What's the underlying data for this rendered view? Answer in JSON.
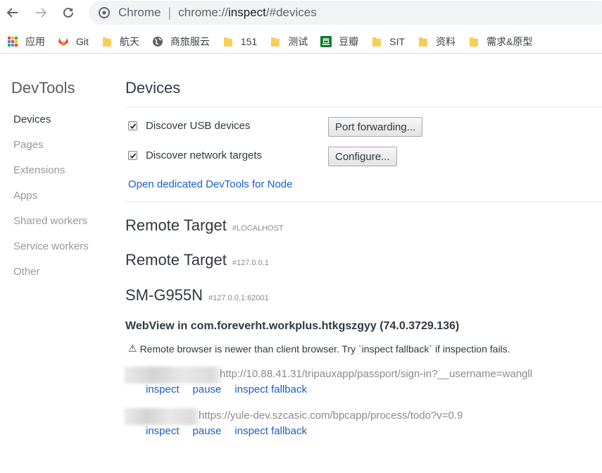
{
  "toolbar": {
    "chrome_label": "Chrome",
    "url_scheme": "chrome://",
    "url_host": "inspect",
    "url_path": "/#devices"
  },
  "bookmarks": [
    {
      "label": "应用",
      "icon": "apps-grid-icon"
    },
    {
      "label": "Git",
      "icon": "gitlab-icon"
    },
    {
      "label": "航天",
      "icon": "folder-icon"
    },
    {
      "label": "商旅服云",
      "icon": "globe-icon"
    },
    {
      "label": "151",
      "icon": "folder-icon"
    },
    {
      "label": "测试",
      "icon": "folder-icon"
    },
    {
      "label": "豆瓣",
      "icon": "douban-icon"
    },
    {
      "label": "SIT",
      "icon": "folder-icon"
    },
    {
      "label": "资料",
      "icon": "folder-icon"
    },
    {
      "label": "需求&原型",
      "icon": "folder-icon"
    }
  ],
  "sidebar": {
    "title": "DevTools",
    "items": [
      {
        "label": "Devices",
        "active": true
      },
      {
        "label": "Pages"
      },
      {
        "label": "Extensions"
      },
      {
        "label": "Apps"
      },
      {
        "label": "Shared workers"
      },
      {
        "label": "Service workers"
      },
      {
        "label": "Other"
      }
    ]
  },
  "main": {
    "title": "Devices",
    "discover_usb": {
      "label": "Discover USB devices",
      "checked": true,
      "button": "Port forwarding..."
    },
    "discover_network": {
      "label": "Discover network targets",
      "checked": true,
      "button": "Configure..."
    },
    "open_node_link": "Open dedicated DevTools for Node",
    "targets": [
      {
        "name": "Remote Target",
        "addr": "#LOCALHOST"
      },
      {
        "name": "Remote Target",
        "addr": "#127.0.0.1"
      },
      {
        "name": "SM-G955N",
        "addr": "#127.0.0.1:62001"
      }
    ],
    "webview_title": "WebView in com.foreverht.workplus.htkgszgyy (74.0.3729.136)",
    "warning_icon": "⚠",
    "warning_text": "Remote browser is newer than client browser. Try `inspect fallback` if inspection fails.",
    "pages": [
      {
        "url": "http://10.88.41.31/tripauxapp/passport/sign-in?__username=wangll",
        "actions": [
          "inspect",
          "pause",
          "inspect fallback"
        ]
      },
      {
        "url": "https://yule-dev.szcasic.com/bpcapp/process/todo?v=0.9",
        "actions": [
          "inspect",
          "pause",
          "inspect fallback"
        ]
      }
    ]
  },
  "colors": {
    "link": "#1a5ec9",
    "text": "#303942",
    "muted": "#999999"
  }
}
